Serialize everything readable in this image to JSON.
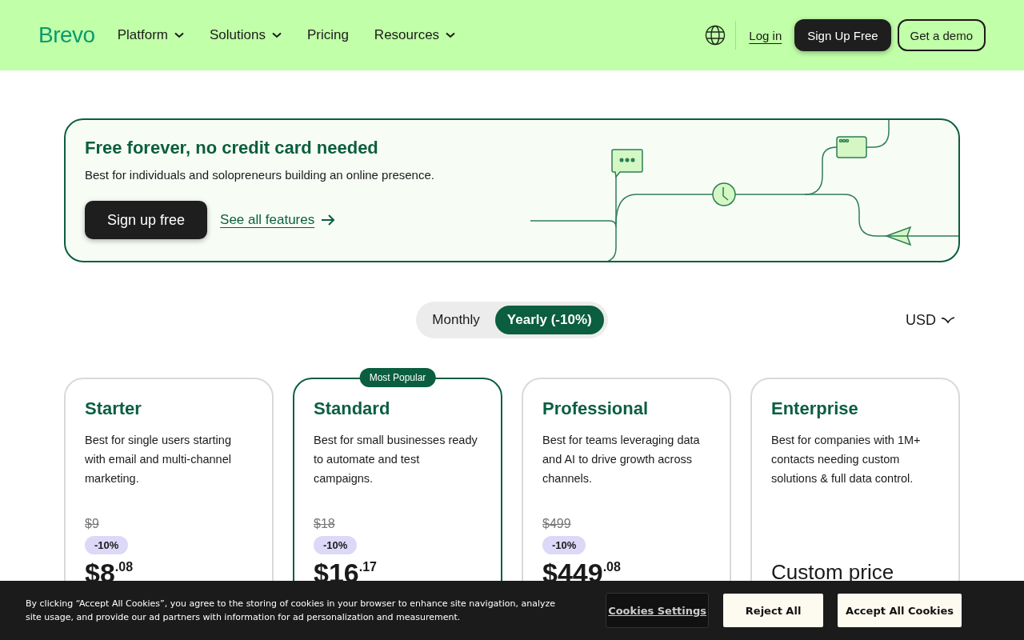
{
  "header": {
    "logo": "Brevo",
    "nav": [
      {
        "label": "Platform",
        "dropdown": true
      },
      {
        "label": "Solutions",
        "dropdown": true
      },
      {
        "label": "Pricing",
        "dropdown": false
      },
      {
        "label": "Resources",
        "dropdown": true
      }
    ],
    "login": "Log in",
    "signup": "Sign Up Free",
    "demo": "Get a demo"
  },
  "hero": {
    "title": "Free forever, no credit card needed",
    "subtitle": "Best for individuals and solopreneurs building an online presence.",
    "button": "Sign up free",
    "link": "See all features"
  },
  "billing": {
    "options": [
      {
        "label": "Monthly",
        "selected": false
      },
      {
        "label": "Yearly (-10%)",
        "selected": true
      }
    ],
    "currency": "USD"
  },
  "plans": [
    {
      "kind": "priced",
      "name": "Starter",
      "description": "Best for single users starting with email and multi-channel marketing.",
      "old_price": "$9",
      "discount": "-10%",
      "price": "$8",
      "cents": ".08"
    },
    {
      "kind": "priced",
      "name": "Standard",
      "badge": "Most Popular",
      "description": "Best for small businesses ready to automate and test campaigns.",
      "old_price": "$18",
      "discount": "-10%",
      "price": "$16",
      "cents": ".17"
    },
    {
      "kind": "priced",
      "name": "Professional",
      "description": "Best for teams leveraging data and AI to drive growth across channels.",
      "old_price": "$499",
      "discount": "-10%",
      "price": "$449",
      "cents": ".08"
    },
    {
      "kind": "custom",
      "name": "Enterprise",
      "description": "Best for companies with 1M+ contacts needing custom solutions & full data control.",
      "price": "Custom price"
    }
  ],
  "cookie_banner": {
    "text": "By clicking “Accept All Cookies”, you agree to the storing of cookies in your browser to enhance site navigation, analyze site usage, and provide our ad partners with information for ad personalization and measurement.",
    "settings": "Cookies Settings",
    "reject": "Reject All",
    "accept": "Accept All Cookies"
  }
}
